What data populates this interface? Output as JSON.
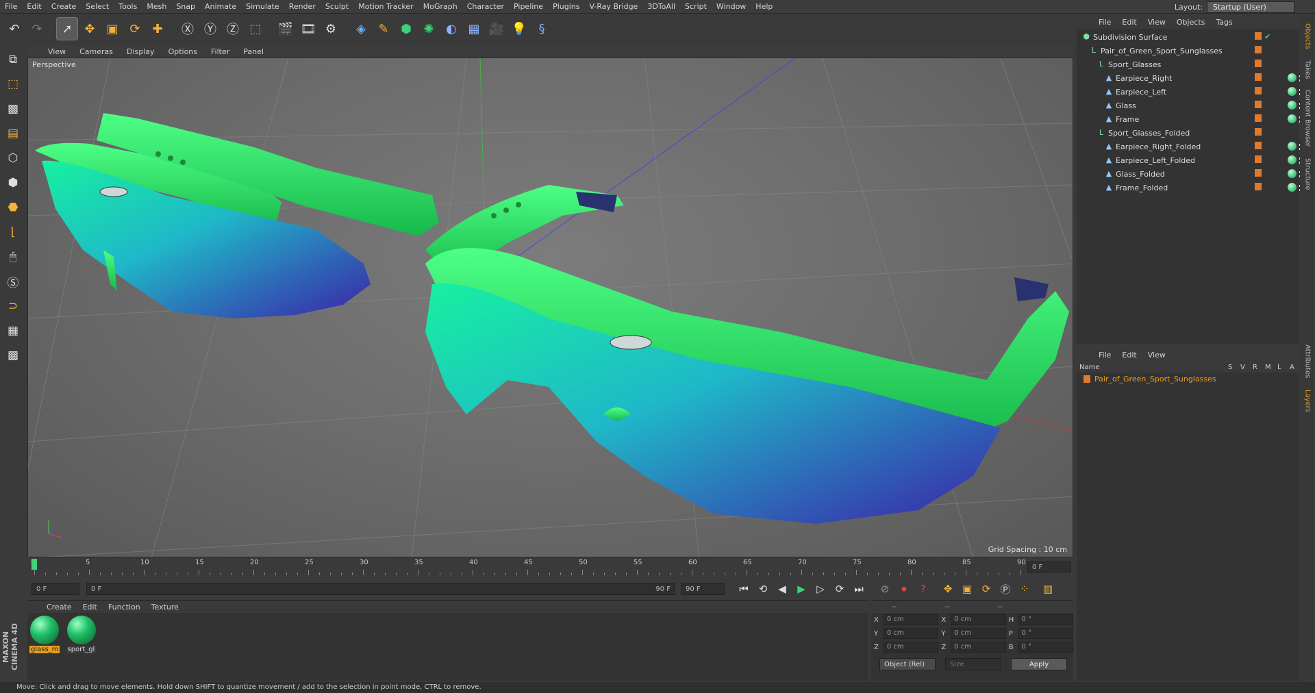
{
  "menubar": {
    "items": [
      "File",
      "Edit",
      "Create",
      "Select",
      "Tools",
      "Mesh",
      "Snap",
      "Animate",
      "Simulate",
      "Render",
      "Sculpt",
      "Motion Tracker",
      "MoGraph",
      "Character",
      "Pipeline",
      "Plugins",
      "V-Ray Bridge",
      "3DToAll",
      "Script",
      "Window",
      "Help"
    ],
    "layout_label": "Layout:",
    "layout_value": "Startup (User)"
  },
  "viewport": {
    "menu": [
      "View",
      "Cameras",
      "Display",
      "Options",
      "Filter",
      "Panel"
    ],
    "label": "Perspective",
    "grid_spacing": "Grid Spacing : 10 cm"
  },
  "timeline": {
    "ticks": [
      0,
      5,
      10,
      15,
      20,
      25,
      30,
      35,
      40,
      45,
      50,
      55,
      60,
      65,
      70,
      75,
      80,
      85,
      90
    ],
    "current_frame": "0 F",
    "start_field": "0 F",
    "range_start": "0 F",
    "range_end": "90 F",
    "end_field": "90 F"
  },
  "material_manager": {
    "menu": [
      "Create",
      "Edit",
      "Function",
      "Texture"
    ],
    "materials": [
      {
        "name": "glass_m",
        "selected": true
      },
      {
        "name": "sport_gl",
        "selected": false
      }
    ]
  },
  "coordinates": {
    "header": [
      "--",
      "--",
      "--"
    ],
    "rows": [
      {
        "a": "X",
        "av": "0 cm",
        "b": "X",
        "bv": "0 cm",
        "c": "H",
        "cv": "0 °"
      },
      {
        "a": "Y",
        "av": "0 cm",
        "b": "Y",
        "bv": "0 cm",
        "c": "P",
        "cv": "0 °"
      },
      {
        "a": "Z",
        "av": "0 cm",
        "b": "Z",
        "bv": "0 cm",
        "c": "B",
        "cv": "0 °"
      }
    ],
    "mode": "Object (Rel)",
    "size": "Size",
    "apply": "Apply"
  },
  "object_manager": {
    "menu": [
      "File",
      "Edit",
      "View",
      "Objects",
      "Tags"
    ],
    "objects": [
      {
        "name": "Subdivision Surface",
        "indent": 0,
        "icon": "subdivision-icon",
        "tags": "check"
      },
      {
        "name": "Pair_of_Green_Sport_Sunglasses",
        "indent": 1,
        "icon": "null-icon",
        "tags": "none"
      },
      {
        "name": "Sport_Glasses",
        "indent": 2,
        "icon": "null-icon",
        "tags": "none"
      },
      {
        "name": "Earpiece_Right",
        "indent": 3,
        "icon": "polygon-icon",
        "tags": "mat"
      },
      {
        "name": "Earpiece_Left",
        "indent": 3,
        "icon": "polygon-icon",
        "tags": "mat"
      },
      {
        "name": "Glass",
        "indent": 3,
        "icon": "polygon-icon",
        "tags": "mat"
      },
      {
        "name": "Frame",
        "indent": 3,
        "icon": "polygon-icon",
        "tags": "mat"
      },
      {
        "name": "Sport_Glasses_Folded",
        "indent": 2,
        "icon": "null-icon",
        "tags": "none"
      },
      {
        "name": "Earpiece_Right_Folded",
        "indent": 3,
        "icon": "polygon-icon",
        "tags": "mat"
      },
      {
        "name": "Earpiece_Left_Folded",
        "indent": 3,
        "icon": "polygon-icon",
        "tags": "mat"
      },
      {
        "name": "Glass_Folded",
        "indent": 3,
        "icon": "polygon-icon",
        "tags": "mat"
      },
      {
        "name": "Frame_Folded",
        "indent": 3,
        "icon": "polygon-icon",
        "tags": "mat"
      }
    ]
  },
  "layer_manager": {
    "menu": [
      "File",
      "Edit",
      "View"
    ],
    "columns": [
      "Name",
      "S",
      "V",
      "R",
      "M",
      "L",
      "A"
    ],
    "layer_name": "Pair_of_Green_Sport_Sunglasses"
  },
  "side_tabs": [
    "Objects",
    "Takes",
    "Content Browser",
    "Structure",
    "Attributes",
    "Layers"
  ],
  "status": "Move: Click and drag to move elements. Hold down SHIFT to quantize movement / add to the selection in point mode, CTRL to remove.",
  "maxon_logo": "MAXON CINEMA 4D",
  "colors": {
    "accent": "#e8a020",
    "lens_green": "#19d38a",
    "lens_blue": "#3b2fa0",
    "frame_green": "#2ff06a"
  }
}
